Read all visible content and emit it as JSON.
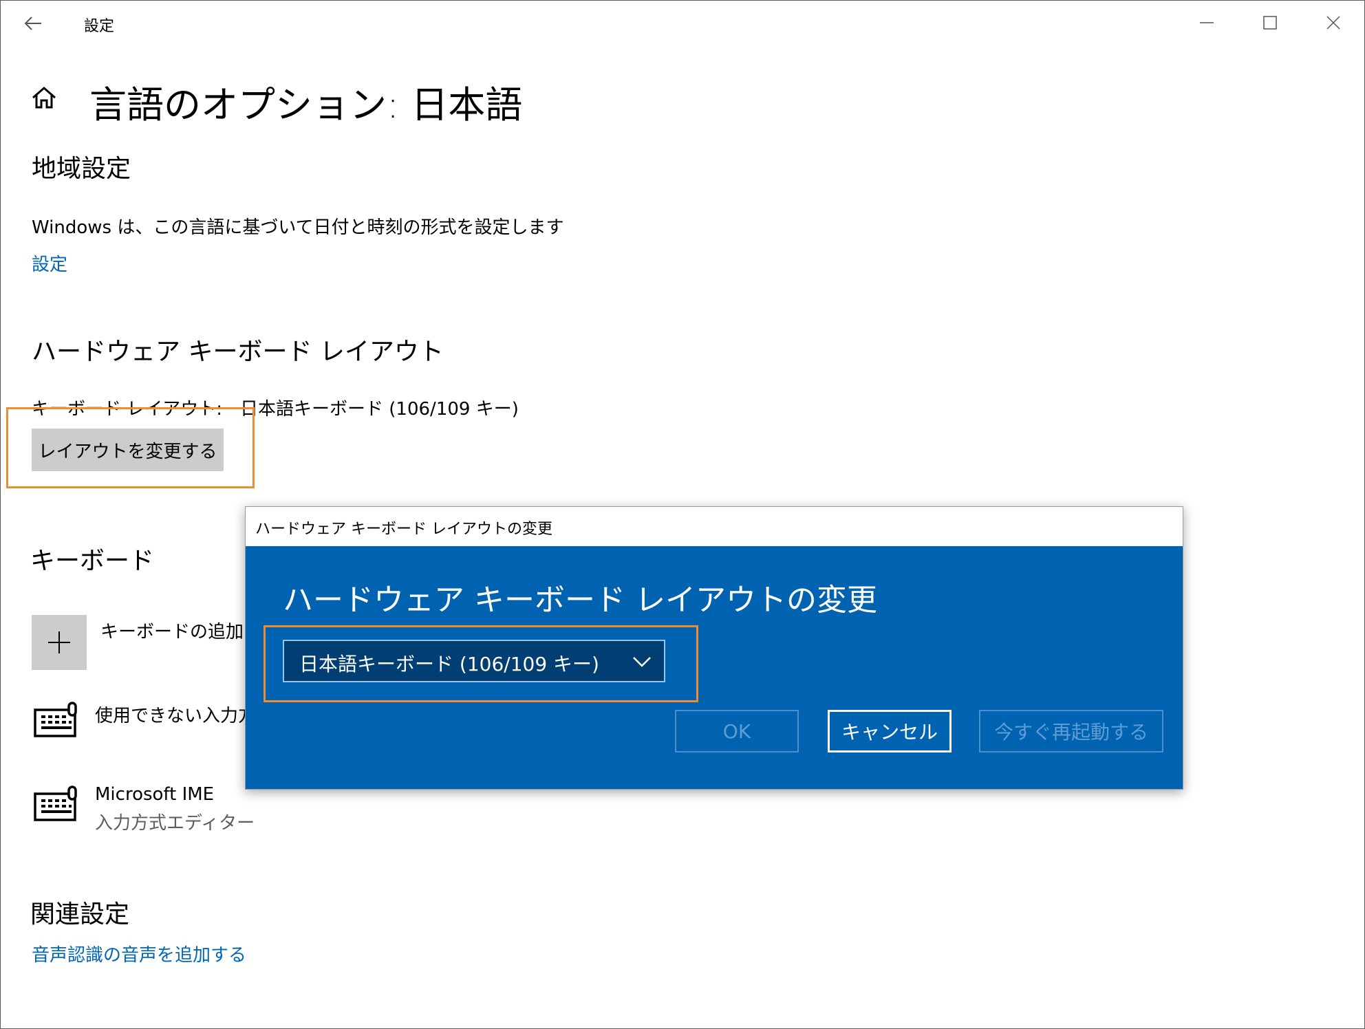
{
  "titlebar": {
    "app_title": "設定",
    "back_icon": "back-arrow-icon",
    "controls": [
      "minimize-icon",
      "maximize-icon",
      "close-icon"
    ]
  },
  "header": {
    "title": "言語のオプション: 日本語",
    "home_icon": "home-icon"
  },
  "region": {
    "heading": "地域設定",
    "description": "Windows は、この言語に基づいて日付と時刻の形式を設定します",
    "link": "設定"
  },
  "hardware_keyboard": {
    "heading": "ハードウェア キーボード レイアウト",
    "layout_label": "キーボード レイアウト:　日本語キーボード (106/109 キー)",
    "change_button": "レイアウトを変更する"
  },
  "keyboard": {
    "heading": "キーボード",
    "add_label": "キーボードの追加",
    "items": [
      {
        "title": "使用できない入力方",
        "subtitle": "",
        "icon": "keyboard-icon"
      },
      {
        "title": "Microsoft IME",
        "subtitle": "入力方式エディター",
        "icon": "keyboard-icon"
      }
    ]
  },
  "related": {
    "heading": "関連設定",
    "link": "音声認識の音声を追加する"
  },
  "dialog": {
    "title": "ハードウェア キーボード レイアウトの変更",
    "heading": "ハードウェア キーボード レイアウトの変更",
    "select_value": "日本語キーボード (106/109 キー)",
    "ok": "OK",
    "cancel": "キャンセル",
    "restart": "今すぐ再起動する"
  },
  "colors": {
    "accent_link": "#0067b8",
    "dialog_blue": "#0063b1",
    "highlight": "#f28a2e"
  }
}
